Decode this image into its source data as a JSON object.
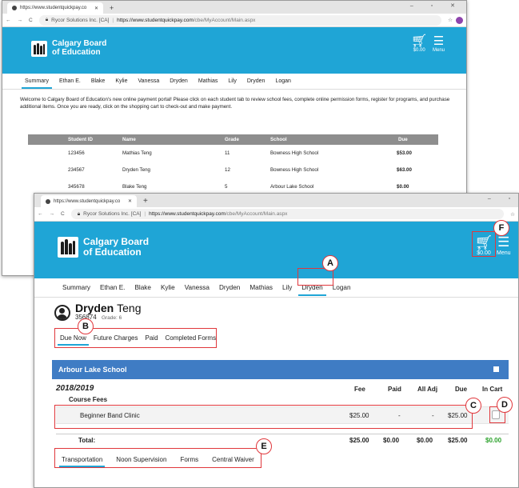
{
  "browser": {
    "tab_title": "https://www.studentquickpay.co",
    "tab_title_front": "https://www.studentquickpay.co",
    "new_tab": "+",
    "window_controls": "–  ▫  ✕",
    "cert_label": "Rycor Solutions Inc. [CA]",
    "url_host": "https://www.studentquickpay.com",
    "url_path": "/cbe/MyAccount/Main.aspx",
    "url_path_front": "/cbe/MyAccount/Main.aspx"
  },
  "brand": {
    "line1": "Calgary Board",
    "line2": "of Education",
    "colors": {
      "banner": "#1fa5d6",
      "school_bar": "#3f7cc4",
      "callout": "#e0373c",
      "total_green": "#2aa12a"
    }
  },
  "header": {
    "cart_total": "$0.00",
    "menu_label": "Menu"
  },
  "nav_tabs_back": [
    "Summary",
    "Ethan E.",
    "Blake",
    "Kylie",
    "Vanessa",
    "Dryden",
    "Mathias",
    "Lily",
    "Dryden",
    "Logan"
  ],
  "nav_tabs_front": [
    "Summary",
    "Ethan E.",
    "Blake",
    "Kylie",
    "Vanessa",
    "Dryden",
    "Mathias",
    "Lily",
    "Dryden",
    "Logan"
  ],
  "welcome_text": "Welcome to Calgary Board of Education's new online payment portal! Please click on each student tab to review school fees, complete online permission forms, register for programs, and purchase additional items. Once you are ready, click on the shopping cart to check-out and make payment.",
  "students_table": {
    "headers": [
      "Student ID",
      "Name",
      "Grade",
      "School",
      "Due"
    ],
    "rows": [
      [
        "123456",
        "Mathias  Teng",
        "11",
        "Bowness High School",
        "$53.00"
      ],
      [
        "234567",
        "Dryden  Teng",
        "12",
        "Bowness High School",
        "$63.00"
      ],
      [
        "345678",
        "Blake  Teng",
        "5",
        "Arbour Lake School",
        "$0.00"
      ]
    ]
  },
  "student": {
    "first_name": "Dryden",
    "last_name": "Teng",
    "id": "356874",
    "grade": "Grade: 6"
  },
  "fee_tabs": [
    "Due Now",
    "Future Charges",
    "Paid",
    "Completed Forms"
  ],
  "school_name": "Arbour Lake School",
  "fees": {
    "year": "2018/2019",
    "columns": [
      "Fee",
      "Paid",
      "All Adj",
      "Due",
      "In Cart"
    ],
    "section": "Course Fees",
    "item": {
      "name": "Beginner Band Clinic",
      "fee": "$25.00",
      "paid": "-",
      "adj": "-",
      "due": "$25.00"
    },
    "total": {
      "label": "Total:",
      "fee": "$25.00",
      "paid": "$0.00",
      "adj": "$0.00",
      "due": "$25.00",
      "in_cart": "$0.00"
    }
  },
  "form_tabs": [
    "Transportation",
    "Noon Supervision",
    "Forms",
    "Central Waiver"
  ],
  "callout_badges": {
    "a": "A",
    "b": "B",
    "c": "C",
    "d": "D",
    "e": "E",
    "f": "F"
  }
}
